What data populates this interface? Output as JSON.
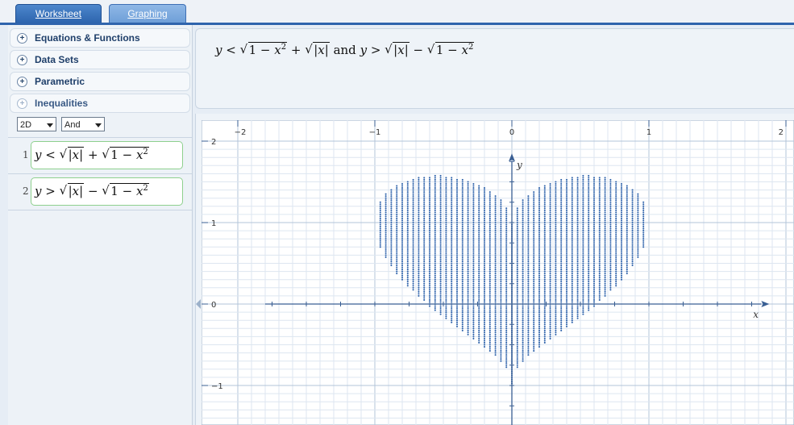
{
  "tabs": [
    {
      "label": "Worksheet",
      "active": false
    },
    {
      "label": "Graphing",
      "active": true
    }
  ],
  "sidebar": {
    "sections": [
      {
        "label": "Equations & Functions",
        "expanded": false,
        "icon": "plus-circle-icon"
      },
      {
        "label": "Data Sets",
        "expanded": false,
        "icon": "plus-circle-icon"
      },
      {
        "label": "Parametric",
        "expanded": false,
        "icon": "plus-circle-icon"
      },
      {
        "label": "Inequalities",
        "expanded": true,
        "icon": "minus-circle-icon"
      }
    ],
    "dimension_select": "2D",
    "logic_select": "And",
    "inequalities": [
      {
        "number": "1",
        "lhs": "y",
        "op": "<",
        "expression": "y < √|x| + √(1 − x²)"
      },
      {
        "number": "2",
        "lhs": "y",
        "op": ">",
        "expression": "y > √|x| − √(1 − x²)"
      }
    ]
  },
  "expression_bar": {
    "text": "y < √(1 − x²) + √|x| and y > √|x| − √(1 − x²)",
    "connector": "and"
  },
  "graph": {
    "x_axis_label": "x",
    "y_axis_label": "y",
    "x_ticks": [
      "−2",
      "−1",
      "0",
      "1",
      "2"
    ],
    "y_ticks": [
      "2",
      "1",
      "0",
      "−1"
    ],
    "xlim": [
      -2.0,
      2.05
    ],
    "ylim": [
      -1.5,
      2.0
    ],
    "point_color": "#2f63ab",
    "axis_color": "#3a5f93",
    "grid_color": "#c6d3e3",
    "fill_region": "√|x| − √(1 − x²) < y < √|x| + √(1 − x²)"
  },
  "colors": {
    "tab_active": "#6a9bd6",
    "tab_inactive": "#2c63ad",
    "accent": "#2f64ad"
  }
}
